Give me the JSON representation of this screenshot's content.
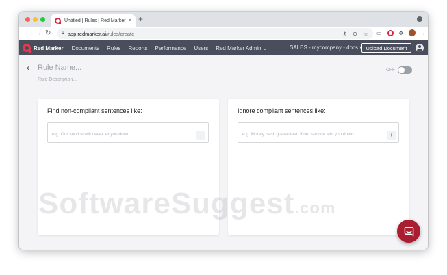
{
  "browser": {
    "tab_title": "Untitled | Rules | Red Marker",
    "tab_close": "×",
    "new_tab": "+",
    "url_host": "app.redmarker.ai",
    "url_path": "/rules/create",
    "icons": [
      "back-arrow-icon",
      "forward-arrow-icon",
      "reload-icon",
      "lock-icon",
      "key-icon",
      "zoom-icon",
      "star-icon",
      "cast-icon",
      "extension-icon",
      "profile-icon",
      "more-icon"
    ]
  },
  "appnav": {
    "brand": "Red Marker",
    "links": [
      "Documents",
      "Rules",
      "Reports",
      "Performance",
      "Users",
      "Red Marker Admin"
    ],
    "org": "SALES - mycompany - docs",
    "upload_label": "Upload Document"
  },
  "rule": {
    "name_placeholder": "Rule Name...",
    "description_placeholder": "Rule Description...",
    "toggle_label": "OFF",
    "enabled": false
  },
  "cards": {
    "noncompliant": {
      "title": "Find non-compliant sentences like:",
      "placeholder": "e.g. Our service will never let you down.",
      "add_label": "+"
    },
    "compliant": {
      "title": "Ignore compliant sentences like:",
      "placeholder": "e.g. Money back guaranteed if our service lets you down.",
      "add_label": "+"
    }
  },
  "watermark": {
    "main": "SoftwareSuggest",
    "suffix": ".com"
  },
  "colors": {
    "nav_bg": "#4a4d5c",
    "brand_red": "#e6394f",
    "chat_red": "#a81d2f",
    "page_bg": "#f4f4f6"
  }
}
